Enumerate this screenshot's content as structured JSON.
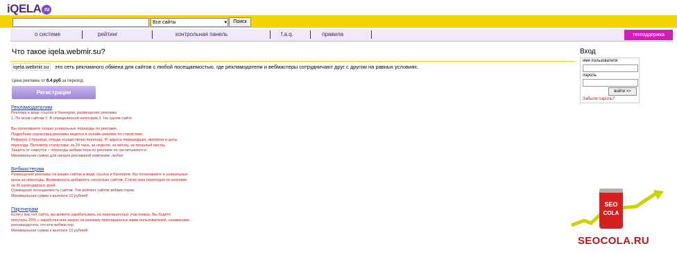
{
  "brand": {
    "logo_text": "iQELA",
    "logo_suffix": "ru"
  },
  "search": {
    "placeholder": "",
    "select_value": "Все сайты",
    "button": "Поиск"
  },
  "nav": {
    "items": [
      "о системе",
      "рейтинг",
      "контрольная панель",
      "f.a.q.",
      "правила"
    ],
    "support": "техподдержка"
  },
  "main": {
    "title": "Что такое iqela.webmir.su?",
    "intro_site": "iqela.webmir.su",
    "intro_text": "это сеть рекламного обмена для сайтов с любой посещаемостью, где рекламодатели и вебмастеры сотрудничают друг с другом на равных условиях.",
    "price_prefix": "Цена рекламы от",
    "price_value": "0.4 руб",
    "price_suffix": "за переход",
    "register_button": "Регистрация"
  },
  "sections": [
    {
      "title": "Рекламодателям",
      "lines": [
        "Реклама в виде ссылок и баннеров, размещение рекламы:",
        "1. По всем сайтам 2. В определенной категории 3. На одном сайте",
        "",
        "Вы оплачиваете только уникальные переходы по рекламе.",
        "Подробная статистика рекламы ведется в онлайн-режиме по статистике:",
        "Реферер (страница, откуда осуществлен переход), IP адреса перешедших, времени и даты",
        "перехода. Просмотр статистики: за 24 часа, за неделю, за месяц, за прошлый месяц.",
        "Защита от накруток – переходы вебмастера по рекламе не засчитываются.",
        "Минимальная сумма для начала рекламной кампании: любая"
      ]
    },
    {
      "title": "Вебмастерам",
      "lines": [
        "Размещение рекламы на ваших сайтах в виде ссылок и баннеров. Вы оплачиваете и уникальные",
        "цены за переходы. Возможность добавлять несколько сайтов. Статистика переходов по рекламе",
        "за 30 календарных дней.",
        "Суммарная посещаемость сайтов. Топ рейтинг сайтов вебмастеров.",
        "Минимальная сумма к выплате 10 рублей!"
      ]
    },
    {
      "title": "Партнерам",
      "lines": [
        "Если у вас нет сайта, вы можете зарабатывать на приглашенных участниках. Вы будете",
        "получать 20% с заработка или затрат на рекламу приглашенных вами пользователей, независимо",
        "рекламодатель это или вебмастер.",
        "Минимальная сумма к выплате 10 рублей!"
      ]
    }
  ],
  "login": {
    "title": "Вход",
    "user_label": "имя пользователя",
    "password_label": "пароль",
    "submit": "войти >>",
    "forgot": "Забыли пароль?"
  },
  "watermark": {
    "text": "SEOCOLA.RU",
    "can_text": "SEO COLA"
  },
  "colors": {
    "accent_yellow": "#f3d400",
    "support_magenta": "#d11db5",
    "link_blue": "#1e3a9c",
    "text_red": "#c0201e"
  }
}
